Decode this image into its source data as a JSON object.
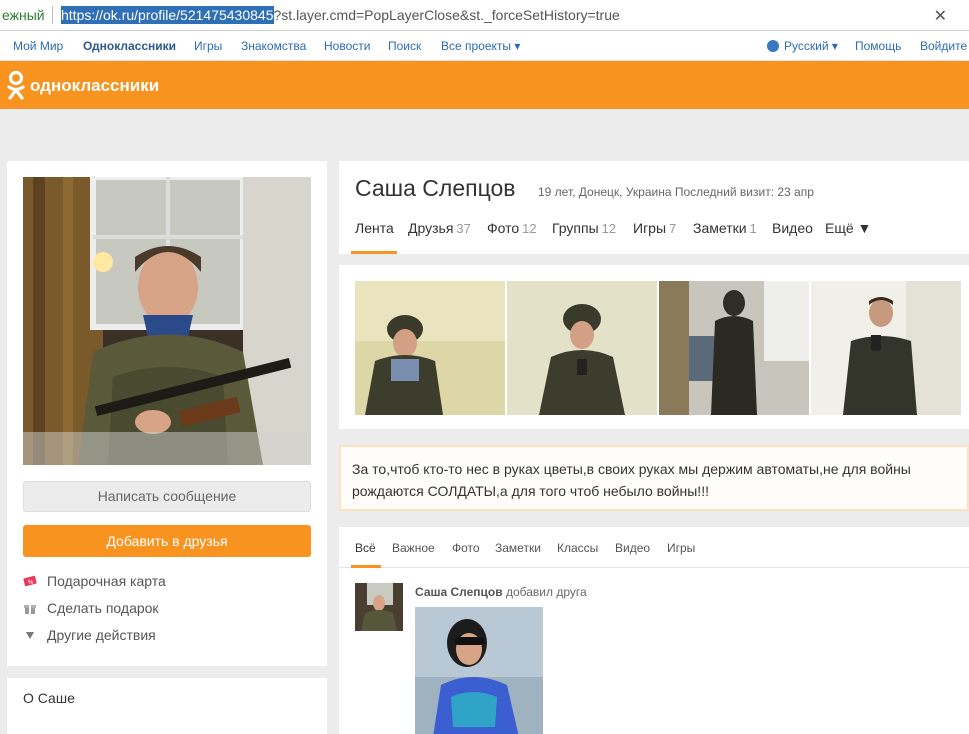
{
  "browser": {
    "site_label": "ежный",
    "url_selected": "https://ok.ru/profile/521475430845",
    "url_rest": "?st.layer.cmd=PopLayerClose&st._forceSetHistory=true",
    "close_glyph": "✕"
  },
  "topnav": {
    "items": [
      "Мой Мир",
      "Одноклассники",
      "Игры",
      "Знакомства",
      "Новости",
      "Поиск",
      "Все проекты ▾"
    ],
    "language": "Русский ▾",
    "help": "Помощь",
    "login": "Войдите"
  },
  "header": {
    "brand": "одноклассники",
    "color": "#f7931e"
  },
  "profile": {
    "name": "Саша Слепцов",
    "meta": "19 лет, Донецк, Украина  Последний визит: 23 апр",
    "tabs": [
      {
        "label": "Лента",
        "count": ""
      },
      {
        "label": "Друзья",
        "count": "37"
      },
      {
        "label": "Фото",
        "count": "12"
      },
      {
        "label": "Группы",
        "count": "12"
      },
      {
        "label": "Игры",
        "count": "7"
      },
      {
        "label": "Заметки",
        "count": "1"
      },
      {
        "label": "Видео",
        "count": ""
      },
      {
        "label": "Ещё ▼",
        "count": ""
      }
    ],
    "status": "За то,чтоб кто-то нес в руках цветы,в своих руках мы держим автоматы,не для войны рождаются СОЛДАТЫ,а для того чтоб небыло войны!!!"
  },
  "left": {
    "write_message": "Написать сообщение",
    "add_friend": "Добавить в друзья",
    "actions": [
      "Подарочная карта",
      "Сделать подарок",
      "Другие действия"
    ],
    "about": "О Саше"
  },
  "feed": {
    "tabs": [
      "Всё",
      "Важное",
      "Фото",
      "Заметки",
      "Классы",
      "Видео",
      "Игры"
    ],
    "author": "Саша Слепцов",
    "action": "добавил друга"
  }
}
